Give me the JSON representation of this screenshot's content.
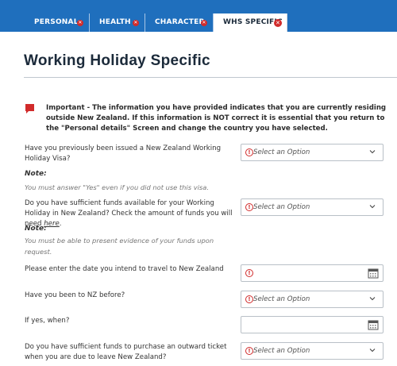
{
  "tabs": [
    {
      "label": "PERSONAL",
      "active": false
    },
    {
      "label": "HEALTH",
      "active": false
    },
    {
      "label": "CHARACTER",
      "active": false
    },
    {
      "label": "WHS SPECIFIC",
      "active": true
    }
  ],
  "page": {
    "title": "Working Holiday Specific"
  },
  "important": "Important - The information you have provided indicates that you are currently residing outside New Zealand. If this information is NOT correct it is essential that you return to the \"Personal details\" Screen and change the country you have selected.",
  "questions": {
    "q1": "Have you previously been issued a New Zealand Working Holiday Visa?",
    "q2_main": "Do you have sufficient funds available for your Working Holiday in New Zealand? Check the amount of funds you will need ",
    "q2_link": "here",
    "q2_end": ".",
    "q3": "Please enter the date you intend to travel to New Zealand",
    "q4": "Have you been to NZ before?",
    "q5": "If yes, when?",
    "q6": "Do you have sufficient funds to purchase an outward ticket when you are due to leave New Zealand?"
  },
  "notes": {
    "heading": "Note:",
    "note1": "You must answer \"Yes\" even if you did not use this visa.",
    "note2": "You must be able to present evidence of your funds upon request."
  },
  "select_placeholder": "Select an Option",
  "colors": {
    "tabbar": "#1f6fbd",
    "warning": "#d12b2b",
    "title": "#1b2a3a"
  }
}
